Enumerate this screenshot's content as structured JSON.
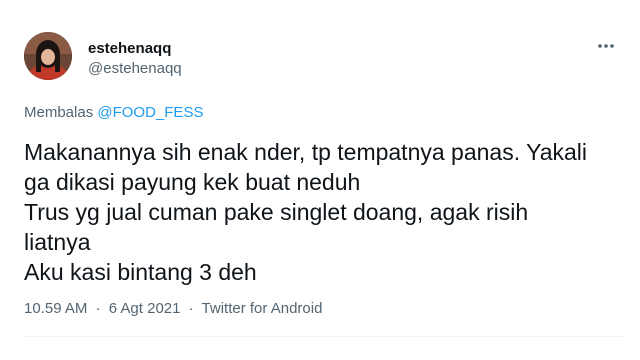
{
  "tweet": {
    "author": {
      "display_name": "estehenaqq",
      "handle": "@estehenaqq"
    },
    "more_icon": "more-horizontal-icon",
    "reply": {
      "prefix": "Membalas",
      "mention": "@FOOD_FESS"
    },
    "text_lines": [
      "Makanannya sih enak nder, tp tempatnya panas. Yakali",
      "ga dikasi payung kek buat neduh",
      "Trus yg jual cuman pake singlet doang, agak risih",
      "liatnya",
      "Aku kasi bintang 3 deh"
    ],
    "meta": {
      "time": "10.59 AM",
      "separator": "·",
      "date": "6 Agt 2021",
      "source": "Twitter for Android"
    },
    "colors": {
      "text": "#0f1419",
      "secondary": "#536471",
      "accent": "#1d9bf0"
    }
  }
}
